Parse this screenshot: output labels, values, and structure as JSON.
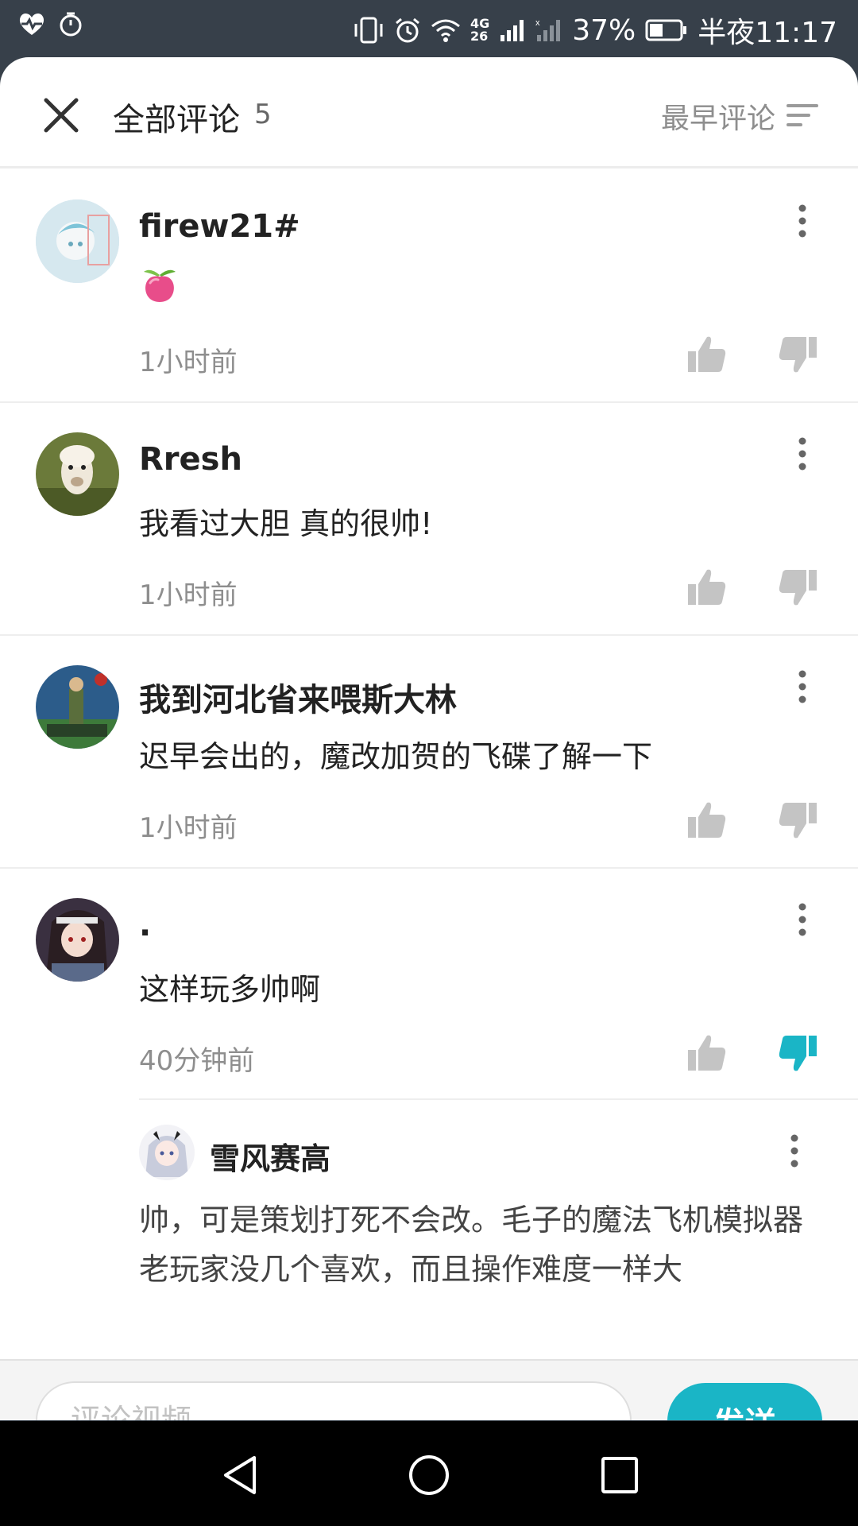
{
  "status_bar": {
    "battery": "37%",
    "network_top": "4G",
    "network_bottom": "26",
    "time": "半夜11:17",
    "icons": [
      "heartbeat-icon",
      "timer-icon",
      "vibrate-icon",
      "alarm-icon",
      "wifi-icon",
      "signal-icon",
      "battery-icon"
    ]
  },
  "header": {
    "title": "全部评论",
    "count": "5",
    "sort_label": "最早评论",
    "icons": [
      "close-icon",
      "sort-icon"
    ]
  },
  "comments": [
    {
      "user": "firew21#",
      "text": "",
      "emoji": "peach-emoji",
      "time": "1小时前",
      "disliked": false,
      "avatar_color": "#cfe3ec"
    },
    {
      "user": "Rresh",
      "text": "我看过大胆 真的很帅!",
      "time": "1小时前",
      "disliked": false,
      "avatar_color": "#6b7a3a"
    },
    {
      "user": "我到河北省来喂斯大林",
      "text": "迟早会出的，魔改加贺的飞碟了解一下",
      "time": "1小时前",
      "disliked": false,
      "avatar_color": "#2c5c8a"
    },
    {
      "user": ".",
      "text": "这样玩多帅啊",
      "time": "40分钟前",
      "disliked": true,
      "avatar_color": "#3a3040"
    }
  ],
  "reply": {
    "user": "雪风赛高",
    "text": "帅，可是策划打死不会改。毛子的魔法飞机模拟器老玩家没几个喜欢，而且操作难度一样大"
  },
  "input": {
    "placeholder": "评论视频",
    "value": ""
  },
  "send_label": "发送",
  "colors": {
    "accent": "#1ab5c6",
    "icon_gray": "#c4c4c4",
    "text_secondary": "#8e8e8e"
  },
  "nav_bar": [
    "back-icon",
    "home-icon",
    "recents-icon"
  ]
}
